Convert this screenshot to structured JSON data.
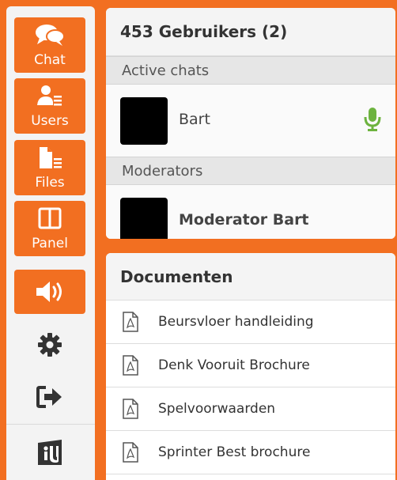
{
  "sidebar": {
    "items": [
      {
        "label": "Chat",
        "icon": "chat-icon"
      },
      {
        "label": "Users",
        "icon": "users-icon"
      },
      {
        "label": "Files",
        "icon": "files-icon"
      },
      {
        "label": "Panel",
        "icon": "panel-icon"
      }
    ],
    "sound_icon": "speaker-icon",
    "settings_icon": "gear-icon",
    "logout_icon": "logout-icon",
    "logo_icon": "brand-logo-icon",
    "accent_color": "#F26F21"
  },
  "users_panel": {
    "title": "453 Gebruikers (2)",
    "sections": [
      {
        "title": "Active chats",
        "users": [
          {
            "name": "Bart",
            "bold": false,
            "mic": true
          }
        ]
      },
      {
        "title": "Moderators",
        "users": [
          {
            "name": "Moderator Bart",
            "bold": true,
            "mic": false
          }
        ]
      }
    ],
    "mic_color": "#6DB33F"
  },
  "docs_panel": {
    "title": "Documenten",
    "documents": [
      {
        "name": "Beursvloer handleiding"
      },
      {
        "name": "Denk Vooruit Brochure"
      },
      {
        "name": "Spelvoorwaarden"
      },
      {
        "name": "Sprinter Best brochure"
      }
    ]
  }
}
